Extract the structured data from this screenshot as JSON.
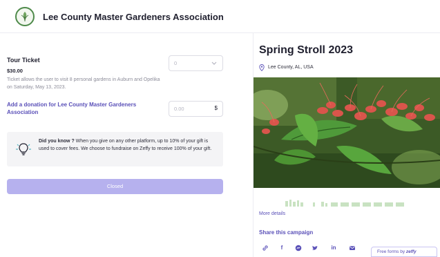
{
  "header": {
    "org_name": "Lee County Master Gardeners Association"
  },
  "ticket": {
    "title": "Tour Ticket",
    "price": "$30.00",
    "description": "Ticket allows the user to visit 8 personal gardens in Auburn and Opelika on Saturday, May 13, 2023.",
    "quantity_value": "0"
  },
  "donation": {
    "label": "Add a donation for Lee County Master Gardeners Association",
    "value": "0.00",
    "currency": "$"
  },
  "info_box": {
    "lead": "Did you know ?",
    "text": " When you give on any other platform, up to 10% of your gift is used to cover fees. We choose to fundraise on Zeffy to receive 100% of your gift."
  },
  "closed_button": {
    "label": "Closed"
  },
  "campaign": {
    "title": "Spring Stroll 2023",
    "location": "Lee County, AL, USA",
    "more_details": "More details",
    "share_title": "Share this campaign"
  },
  "share_icons": [
    "link-icon",
    "facebook-icon",
    "messenger-icon",
    "twitter-icon",
    "linkedin-icon",
    "email-icon"
  ],
  "share_labels": {
    "facebook": "f",
    "linkedin": "in"
  },
  "zeffy_badge": {
    "prefix": "Free forms by ",
    "brand": "zeffy"
  },
  "colors": {
    "accent": "#5a50b8",
    "button_disabled": "#b6b1ee",
    "info_bg": "#f4f4f6",
    "logo_green": "#4e8a4a"
  }
}
